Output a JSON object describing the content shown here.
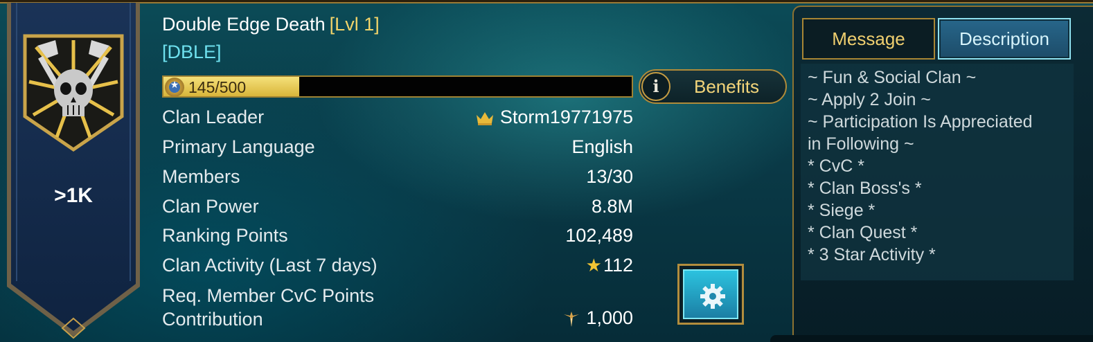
{
  "clan": {
    "name": "Double Edge Death",
    "level": "[Lvl 1]",
    "tag": "[DBLE]",
    "rank": ">1K",
    "xp_text": "145/500",
    "xp_progress": 0.29
  },
  "info_rows": [
    {
      "label": "Clan Leader",
      "value": "Storm19771975",
      "icon": "crown-icon"
    },
    {
      "label": "Primary Language",
      "value": "English"
    },
    {
      "label": "Members",
      "value": "13/30"
    },
    {
      "label": "Clan Power",
      "value": "8.8M"
    },
    {
      "label": "Ranking Points",
      "value": "102,489"
    },
    {
      "label": "Clan Activity (Last 7 days)",
      "value": "112",
      "icon": "star-icon"
    }
  ],
  "cvc_row": {
    "label_line1": "Req. Member CvC Points",
    "label_line2": "Contribution",
    "value": "1,000",
    "icon": "cvc-points-icon"
  },
  "buttons": {
    "benefits": "Benefits",
    "settings_icon": "gear-icon"
  },
  "tabs": {
    "message": "Message",
    "description": "Description",
    "active": "description"
  },
  "description_lines": [
    "~ Fun & Social Clan ~",
    "~ Apply 2 Join ~",
    "~ Participation Is Appreciated",
    "in Following ~",
    "* CvC *",
    "* Clan Boss's *",
    "* Siege *",
    "* Clan Quest *",
    "* 3 Star Activity *"
  ],
  "colors": {
    "gold": "#f2d46a",
    "tag_cyan": "#6ee0ee",
    "banner_navy": "#12294a"
  }
}
